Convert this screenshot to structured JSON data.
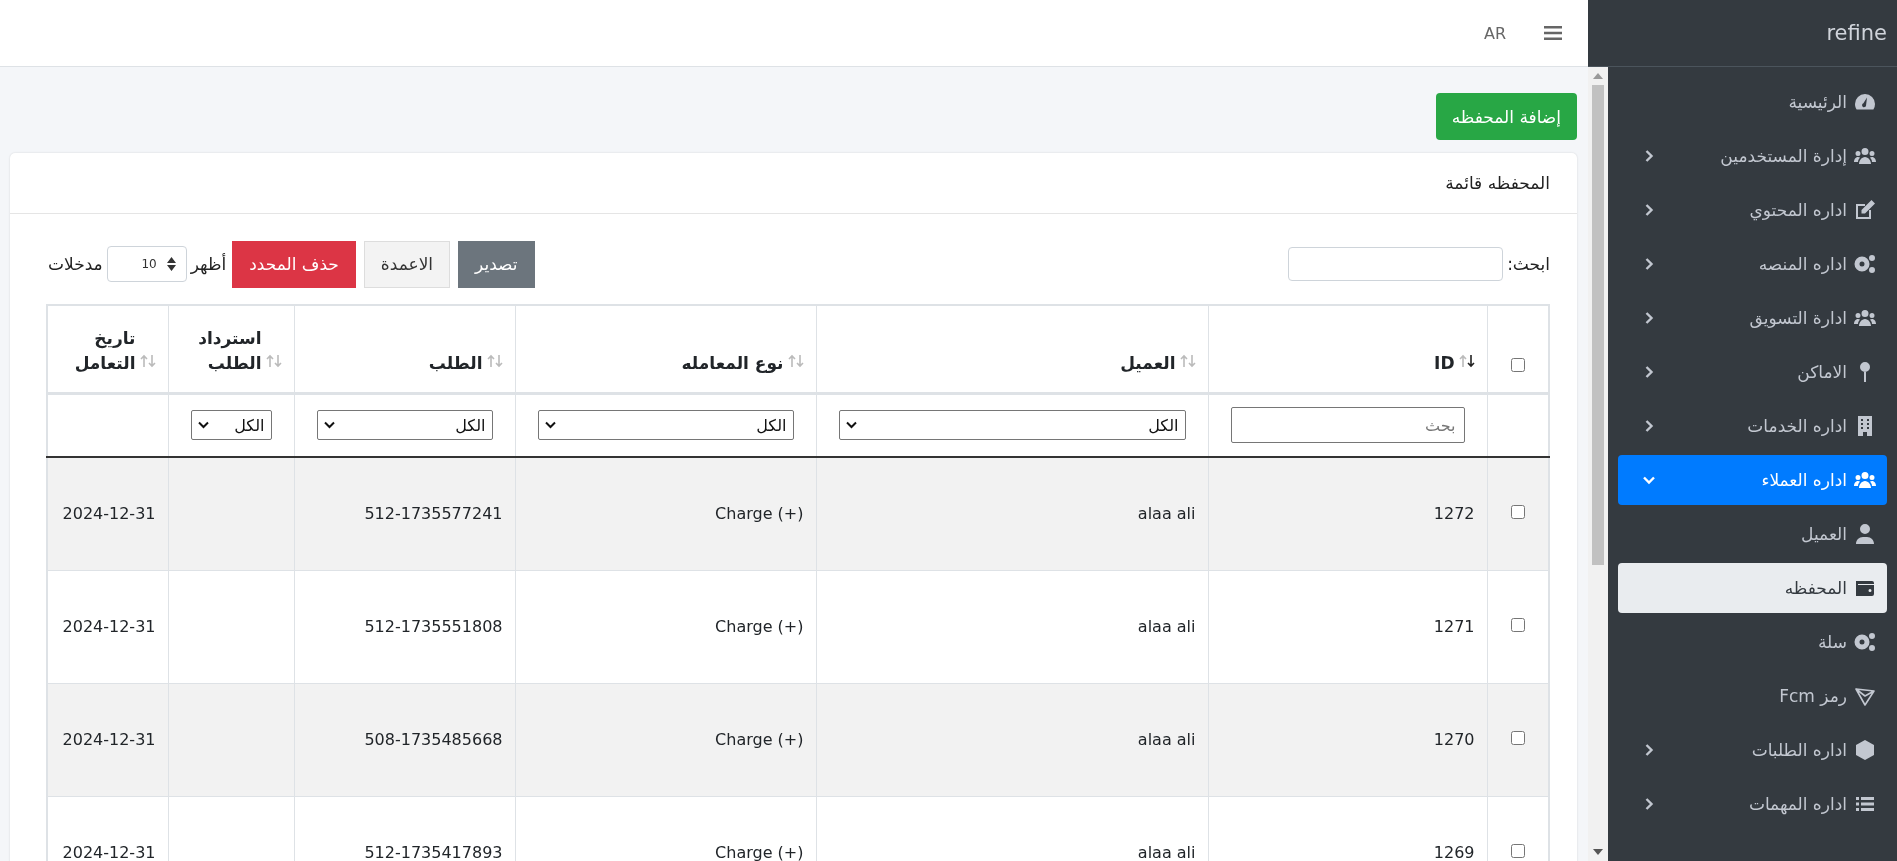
{
  "header": {
    "language": "AR"
  },
  "sidebar": {
    "brand": "refine",
    "items": [
      {
        "label": "الرئيسية",
        "kind": "link",
        "selected": false
      },
      {
        "label": "إدارة المستخدمين",
        "kind": "group",
        "expanded": false,
        "selected": false
      },
      {
        "label": "اداره المحتوي",
        "kind": "group",
        "expanded": false,
        "selected": false
      },
      {
        "label": "اداره المنصه",
        "kind": "group",
        "expanded": false,
        "selected": false
      },
      {
        "label": "ادارة التسويق",
        "kind": "group",
        "expanded": false,
        "selected": false
      },
      {
        "label": "الاماكن",
        "kind": "group",
        "expanded": false,
        "selected": false
      },
      {
        "label": "اداره الخدمات",
        "kind": "group",
        "expanded": false,
        "selected": false
      },
      {
        "label": "اداره العملاء",
        "kind": "group",
        "expanded": true,
        "selected": true,
        "children": [
          {
            "label": "العميل",
            "selected": false
          },
          {
            "label": "المحفظه",
            "selected": true
          },
          {
            "label": "سلة",
            "selected": false
          },
          {
            "label": "رمز Fcm",
            "selected": false
          }
        ]
      },
      {
        "label": "اداره الطلبات",
        "kind": "group",
        "expanded": false,
        "selected": false
      },
      {
        "label": "اداره المهمات",
        "kind": "group",
        "expanded": false,
        "selected": false
      }
    ]
  },
  "add_button": "إضافة المحفظه",
  "card": {
    "title": "المحفظه قائمة",
    "search": {
      "label": "ابحث:"
    },
    "buttons": [
      {
        "label": "تصدير",
        "kind": "secondary"
      },
      {
        "label": "الاعمدة",
        "kind": "light"
      },
      {
        "label": "حذف المحدد",
        "kind": "danger"
      }
    ],
    "page_length": {
      "before": "أظهر",
      "value": "10",
      "after": "مدخلات"
    },
    "table": {
      "select_all_checked": false,
      "columns": [
        {
          "label": "ID",
          "sorted": true,
          "filter": {
            "kind": "input",
            "placeholder": "بحث"
          }
        },
        {
          "label": "العميل",
          "sorted": false,
          "filter": {
            "kind": "select",
            "value": "الكل"
          }
        },
        {
          "label": "نوع المعامله",
          "sorted": false,
          "filter": {
            "kind": "select",
            "value": "الكل"
          }
        },
        {
          "label": "الطلب",
          "sorted": false,
          "filter": {
            "kind": "select",
            "value": "الكل"
          }
        },
        {
          "label": "استرداد الطلب",
          "sorted": false,
          "filter": {
            "kind": "select",
            "value": "الكل"
          }
        },
        {
          "label": "تاريخ التعامل",
          "sorted": false
        }
      ],
      "rows": [
        {
          "checked": false,
          "cells": [
            "1272",
            "alaa ali",
            "Charge (+)",
            "512-1735577241",
            "",
            "2024-12-31"
          ]
        },
        {
          "checked": false,
          "cells": [
            "1271",
            "alaa ali",
            "Charge (+)",
            "512-1735551808",
            "",
            "2024-12-31"
          ]
        },
        {
          "checked": false,
          "cells": [
            "1270",
            "alaa ali",
            "Charge (+)",
            "508-1735485668",
            "",
            "2024-12-31"
          ]
        },
        {
          "checked": false,
          "cells": [
            "1269",
            "alaa ali",
            "Charge (+)",
            "512-1735417893",
            "",
            "2024-12-31"
          ]
        }
      ]
    }
  }
}
